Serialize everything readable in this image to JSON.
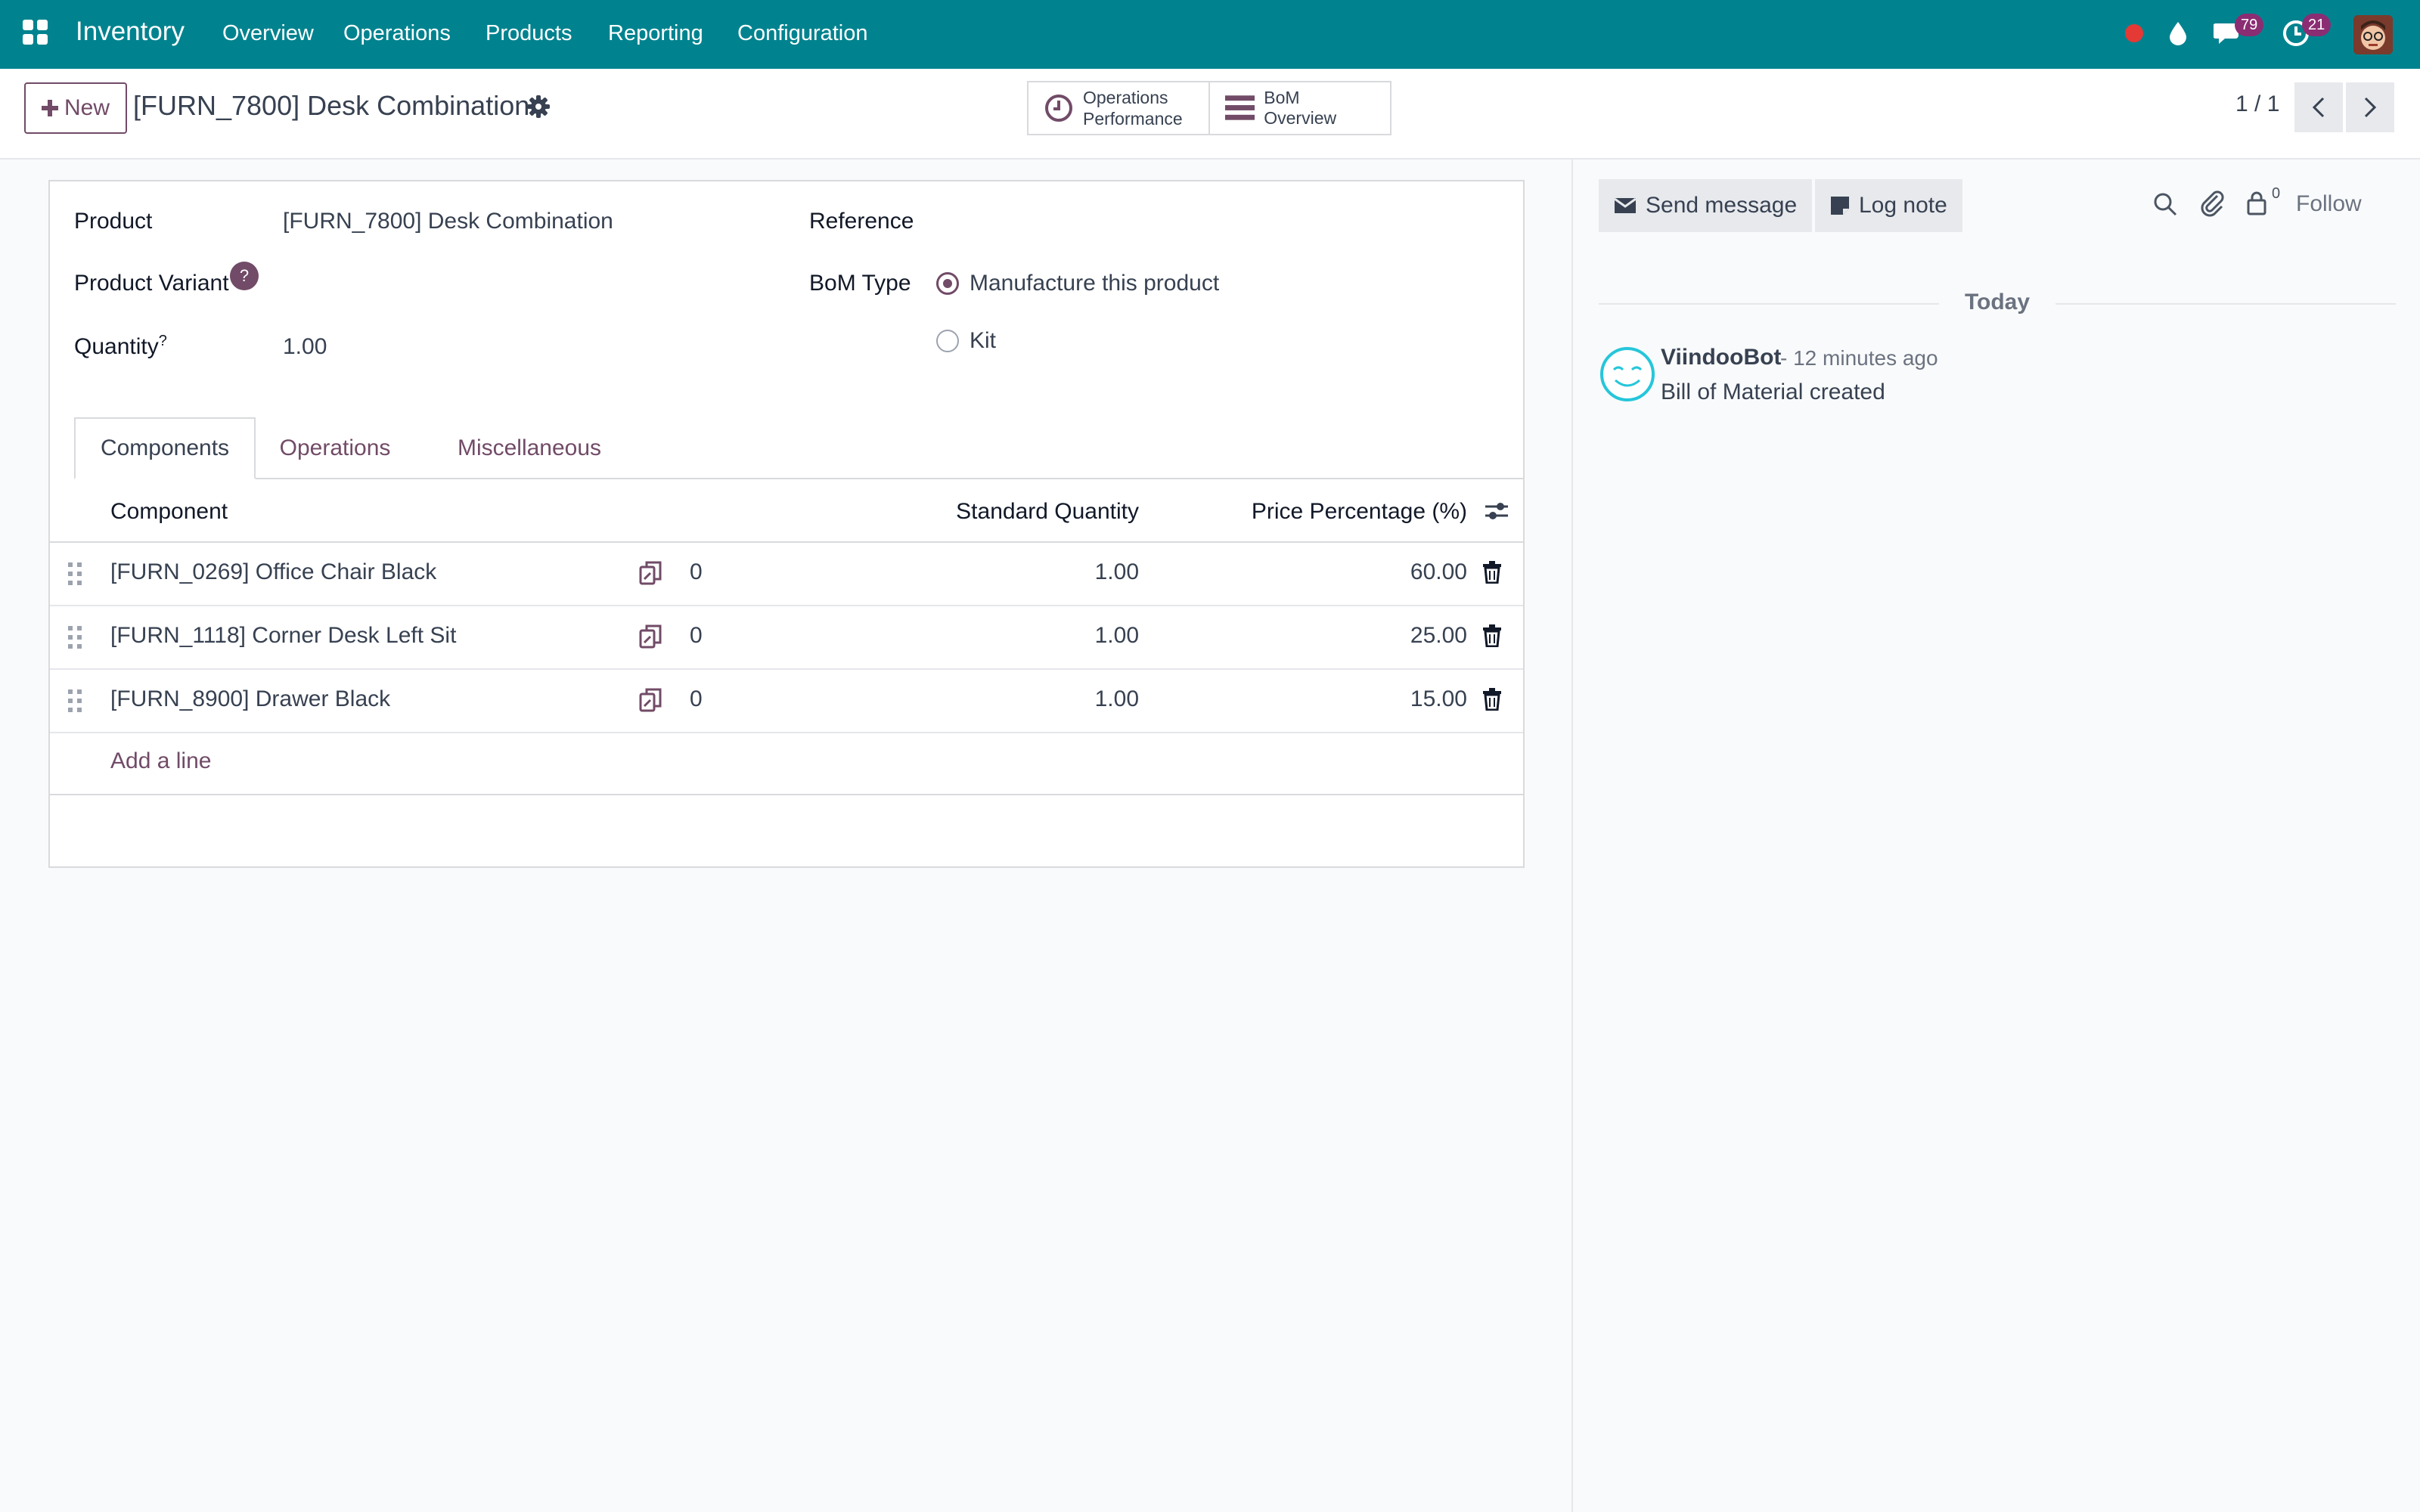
{
  "navbar": {
    "brand": "Inventory",
    "menu": [
      "Overview",
      "Operations",
      "Products",
      "Reporting",
      "Configuration"
    ],
    "messages_count": "79",
    "activities_count": "21",
    "icons": [
      "apps-grid-icon",
      "record-dot-icon",
      "drop-icon",
      "chat-icon",
      "clock-icon",
      "avatar"
    ]
  },
  "control_panel": {
    "new_label": "New",
    "title": "[FURN_7800] Desk Combination",
    "smart_buttons": [
      {
        "line1": "Operations",
        "line2": "Performance",
        "icon": "clock-icon"
      },
      {
        "label": "BoM Overview",
        "icon": "bars-icon"
      }
    ],
    "pager": "1 / 1"
  },
  "form": {
    "product_label": "Product",
    "product_value": "[FURN_7800] Desk Combination",
    "variant_label": "Product Variant",
    "variant_help": "?",
    "quantity_label": "Quantity",
    "quantity_sup": "?",
    "quantity_value": "1.00",
    "reference_label": "Reference",
    "bom_type_label": "BoM Type",
    "bom_type_options": [
      "Manufacture this product",
      "Kit"
    ],
    "bom_type_selected": "Manufacture this product"
  },
  "tabs": [
    "Components",
    "Operations",
    "Miscellaneous"
  ],
  "components": {
    "headers": {
      "component": "Component",
      "std_qty": "Standard Quantity",
      "price_pct": "Price Percentage (%)"
    },
    "rows": [
      {
        "name": "[FURN_0269] Office Chair Black",
        "count": "0",
        "qty": "1.00",
        "pct": "60.00"
      },
      {
        "name": "[FURN_1118] Corner Desk Left Sit",
        "count": "0",
        "qty": "1.00",
        "pct": "25.00"
      },
      {
        "name": "[FURN_8900] Drawer Black",
        "count": "0",
        "qty": "1.00",
        "pct": "15.00"
      }
    ],
    "add_line": "Add a line"
  },
  "chatter": {
    "send_message": "Send message",
    "log_note": "Log note",
    "followers_count": "0",
    "follow": "Follow",
    "date_separator": "Today",
    "message": {
      "author": "ViindooBot",
      "time": "- 12 minutes ago",
      "body": "Bill of Material created"
    }
  },
  "colors": {
    "navbar": "#00838f",
    "primary": "#714b67",
    "badge": "#8b2d73"
  }
}
